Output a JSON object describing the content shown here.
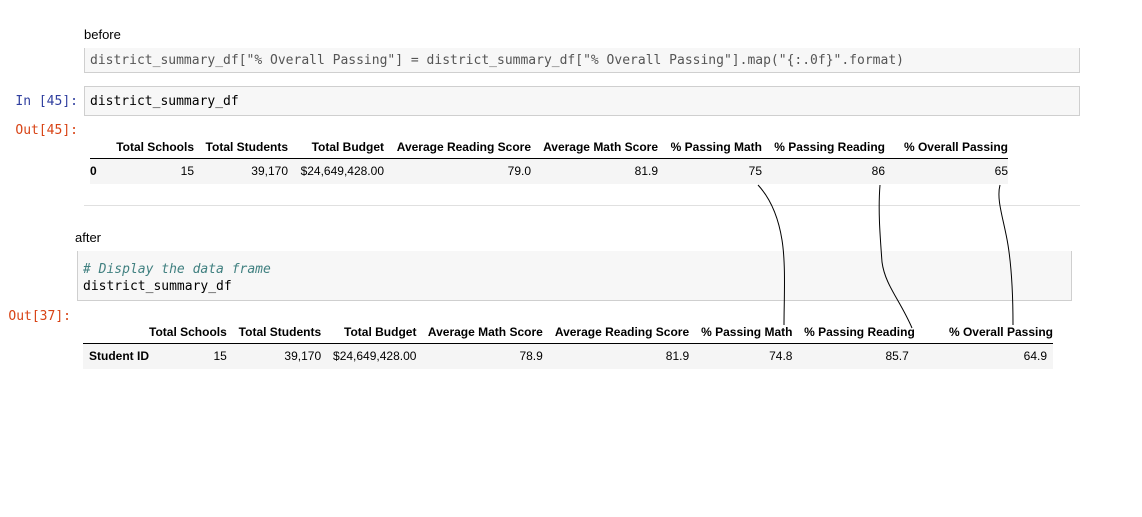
{
  "notes": {
    "before": "before",
    "after": "after"
  },
  "before": {
    "partial_code_left": "district_summary_df[\"% Overall Passing\"] = district_summary_df[\"% Overall Passing\"].map(\"{:.0f}\".format)",
    "in_prompt": "In [45]:",
    "code": "district_summary_df",
    "out_prompt": "Out[45]:",
    "table": {
      "headers": [
        "",
        "Total Schools",
        "Total Students",
        "Total Budget",
        "Average Reading Score",
        "Average Math Score",
        "% Passing Math",
        "% Passing Reading",
        "% Overall Passing"
      ],
      "rows": [
        [
          "0",
          "15",
          "39,170",
          "$24,649,428.00",
          "79.0",
          "81.9",
          "75",
          "86",
          "65"
        ]
      ]
    }
  },
  "after": {
    "comment": "# Display the data frame",
    "code": "district_summary_df",
    "out_prompt": "Out[37]:",
    "table": {
      "headers": [
        "",
        "Total Schools",
        "Total Students",
        "Total Budget",
        "Average Math Score",
        "Average Reading Score",
        "% Passing Math",
        "% Passing Reading",
        "% Overall Passing"
      ],
      "rows": [
        [
          "Student ID",
          "15",
          "39,170",
          "$24,649,428.00",
          "78.9",
          "81.9",
          "74.8",
          "85.7",
          "64.9"
        ]
      ]
    }
  }
}
